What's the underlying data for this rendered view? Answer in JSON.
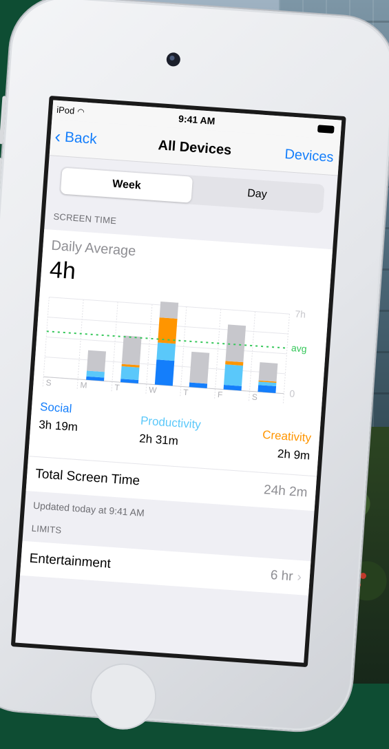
{
  "status": {
    "carrier": "iPod",
    "time": "9:41 AM"
  },
  "nav": {
    "back_label": "Back",
    "title": "All Devices",
    "right_label": "Devices"
  },
  "segments": {
    "week": "Week",
    "day": "Day",
    "selected": "week"
  },
  "screen_time": {
    "section_header": "SCREEN TIME",
    "daily_average_label": "Daily Average",
    "daily_average_value": "4h"
  },
  "colors": {
    "social": "#147efb",
    "productivity": "#5ac8fa",
    "creativity": "#ff9500",
    "other": "#c7c7cc",
    "avg_line": "#34c759",
    "tint": "#147efb"
  },
  "chart_data": {
    "type": "bar",
    "stacked": true,
    "categories": [
      "S",
      "M",
      "T",
      "W",
      "T",
      "F",
      "S"
    ],
    "ylim": [
      0,
      7
    ],
    "yticks": [
      {
        "value": 0,
        "label": "0"
      },
      {
        "value": 7,
        "label": "7h"
      }
    ],
    "avg": {
      "value": 4,
      "label": "avg"
    },
    "grid": true,
    "series": [
      {
        "name": "Social",
        "values": [
          0,
          0.3,
          0.3,
          2.2,
          0.4,
          0.4,
          0.6
        ]
      },
      {
        "name": "Productivity",
        "values": [
          0,
          0.5,
          1.1,
          1.5,
          0,
          1.8,
          0.3
        ]
      },
      {
        "name": "Creativity",
        "values": [
          0,
          0,
          0.2,
          2.2,
          0,
          0.3,
          0.1
        ]
      },
      {
        "values": [
          0,
          1.8,
          2.5,
          1.4,
          2.7,
          3.2,
          1.6
        ]
      }
    ]
  },
  "legend": [
    {
      "name": "Social",
      "value": "3h 19m"
    },
    {
      "name": "Productivity",
      "value": "2h 31m"
    },
    {
      "name": "Creativity",
      "value": "2h 9m"
    }
  ],
  "total": {
    "label": "Total Screen Time",
    "value": "24h 2m"
  },
  "updated": "Updated today at 9:41 AM",
  "limits": {
    "section_header": "LIMITS",
    "item_label": "Entertainment",
    "item_value": "6 hr"
  }
}
